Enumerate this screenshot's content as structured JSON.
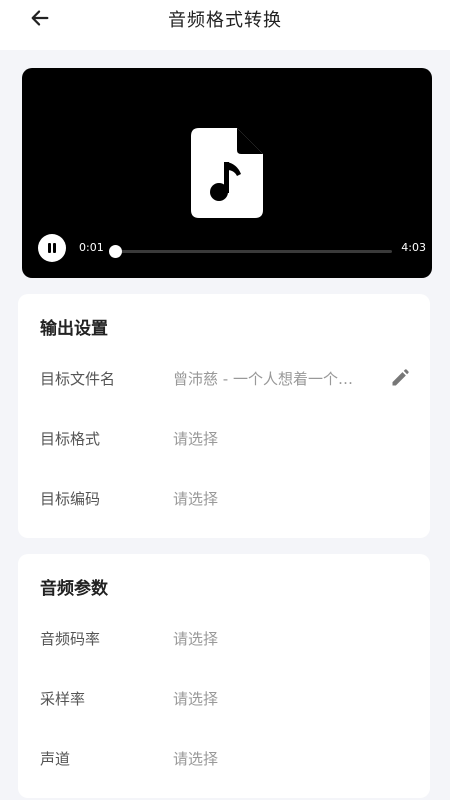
{
  "header": {
    "title": "音频格式转换",
    "back_icon": "arrow-left-icon"
  },
  "player": {
    "icon": "audio-file-icon",
    "play_state_icon": "pause-icon",
    "current_time": "0:01",
    "duration": "4:03",
    "progress": 0.004
  },
  "output_settings": {
    "title": "输出设置",
    "rows": [
      {
        "label": "目标文件名",
        "value": "曾沛慈 - 一个人想着一个…",
        "icon": "pencil-icon"
      },
      {
        "label": "目标格式",
        "value": "请选择"
      },
      {
        "label": "目标编码",
        "value": "请选择"
      }
    ]
  },
  "audio_params": {
    "title": "音频参数",
    "rows": [
      {
        "label": "音频码率",
        "value": "请选择"
      },
      {
        "label": "采样率",
        "value": "请选择"
      },
      {
        "label": "声道",
        "value": "请选择"
      }
    ]
  }
}
